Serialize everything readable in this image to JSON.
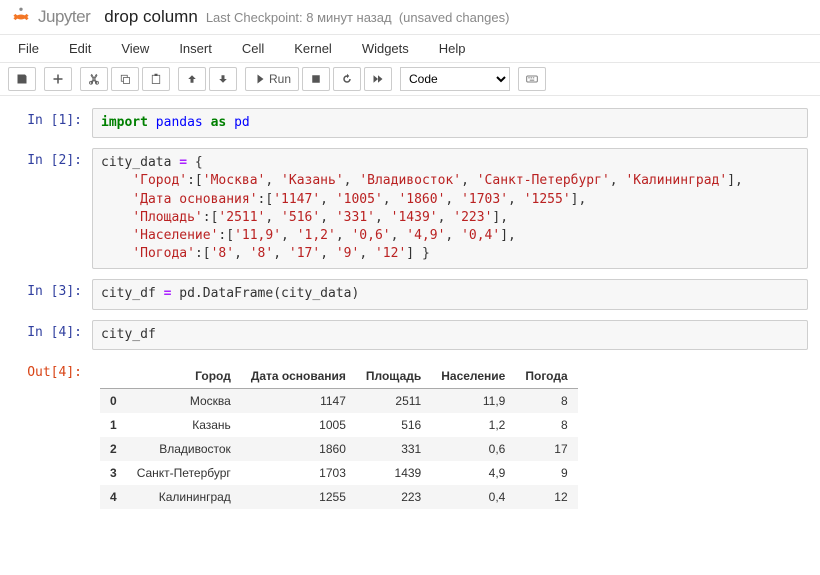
{
  "header": {
    "brand": "Jupyter",
    "notebook_title": "drop column",
    "checkpoint": "Last Checkpoint: 8 минут назад",
    "unsaved": "(unsaved changes)"
  },
  "menu": {
    "file": "File",
    "edit": "Edit",
    "view": "View",
    "insert": "Insert",
    "cell": "Cell",
    "kernel": "Kernel",
    "widgets": "Widgets",
    "help": "Help"
  },
  "toolbar": {
    "run_label": "Run",
    "celltype": "Code"
  },
  "cells": {
    "c1": {
      "prompt": "In [1]:",
      "code_html": "<span class='kw'>import</span> <span class='nn'>pandas</span> <span class='kw'>as</span> <span class='nn'>pd</span>"
    },
    "c2": {
      "prompt": "In [2]:",
      "code_html": "city_data <span class='op'>=</span> {\n    <span class='s'>'Город'</span>:[<span class='s'>'Москва'</span>, <span class='s'>'Казань'</span>, <span class='s'>'Владивосток'</span>, <span class='s'>'Санкт-Петербург'</span>, <span class='s'>'Калининград'</span>],\n    <span class='s'>'Дата основания'</span>:[<span class='s'>'1147'</span>, <span class='s'>'1005'</span>, <span class='s'>'1860'</span>, <span class='s'>'1703'</span>, <span class='s'>'1255'</span>],\n    <span class='s'>'Площадь'</span>:[<span class='s'>'2511'</span>, <span class='s'>'516'</span>, <span class='s'>'331'</span>, <span class='s'>'1439'</span>, <span class='s'>'223'</span>],\n    <span class='s'>'Население'</span>:[<span class='s'>'11,9'</span>, <span class='s'>'1,2'</span>, <span class='s'>'0,6'</span>, <span class='s'>'4,9'</span>, <span class='s'>'0,4'</span>],\n    <span class='s'>'Погода'</span>:[<span class='s'>'8'</span>, <span class='s'>'8'</span>, <span class='s'>'17'</span>, <span class='s'>'9'</span>, <span class='s'>'12'</span>] }"
    },
    "c3": {
      "prompt": "In [3]:",
      "code_html": "city_df <span class='op'>=</span> pd.DataFrame(city_data)"
    },
    "c4": {
      "prompt": "In [4]:",
      "code_html": "city_df"
    },
    "o4": {
      "prompt": "Out[4]:"
    }
  },
  "df": {
    "columns": [
      "Город",
      "Дата основания",
      "Площадь",
      "Население",
      "Погода"
    ],
    "index": [
      "0",
      "1",
      "2",
      "3",
      "4"
    ],
    "rows": [
      [
        "Москва",
        "1147",
        "2511",
        "11,9",
        "8"
      ],
      [
        "Казань",
        "1005",
        "516",
        "1,2",
        "8"
      ],
      [
        "Владивосток",
        "1860",
        "331",
        "0,6",
        "17"
      ],
      [
        "Санкт-Петербург",
        "1703",
        "1439",
        "4,9",
        "9"
      ],
      [
        "Калининград",
        "1255",
        "223",
        "0,4",
        "12"
      ]
    ]
  }
}
